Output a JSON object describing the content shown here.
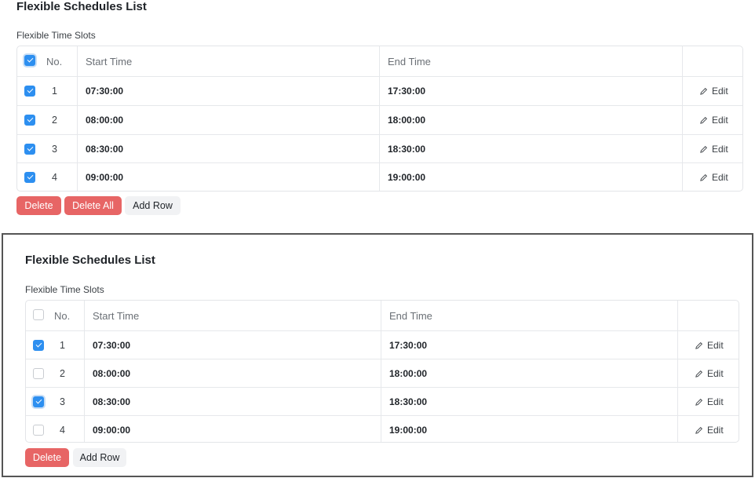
{
  "panels": [
    {
      "title": "Flexible Schedules List",
      "subtitle": "Flexible Time Slots",
      "header": {
        "no": "No.",
        "start": "Start Time",
        "end": "End Time",
        "select_all_checked": true
      },
      "rows": [
        {
          "no": "1",
          "start": "07:30:00",
          "end": "17:30:00",
          "checked": true,
          "edit": "Edit"
        },
        {
          "no": "2",
          "start": "08:00:00",
          "end": "18:00:00",
          "checked": true,
          "edit": "Edit"
        },
        {
          "no": "3",
          "start": "08:30:00",
          "end": "18:30:00",
          "checked": true,
          "edit": "Edit"
        },
        {
          "no": "4",
          "start": "09:00:00",
          "end": "19:00:00",
          "checked": true,
          "edit": "Edit"
        }
      ],
      "buttons": {
        "delete": "Delete",
        "delete_all": "Delete All",
        "add_row": "Add Row"
      }
    },
    {
      "title": "Flexible Schedules List",
      "subtitle": "Flexible Time Slots",
      "header": {
        "no": "No.",
        "start": "Start Time",
        "end": "End Time",
        "select_all_checked": false
      },
      "rows": [
        {
          "no": "1",
          "start": "07:30:00",
          "end": "17:30:00",
          "checked": true,
          "edit": "Edit"
        },
        {
          "no": "2",
          "start": "08:00:00",
          "end": "18:00:00",
          "checked": false,
          "edit": "Edit"
        },
        {
          "no": "3",
          "start": "08:30:00",
          "end": "18:30:00",
          "checked": true,
          "edit": "Edit"
        },
        {
          "no": "4",
          "start": "09:00:00",
          "end": "19:00:00",
          "checked": false,
          "edit": "Edit"
        }
      ],
      "buttons": {
        "delete": "Delete",
        "add_row": "Add Row"
      }
    }
  ],
  "colors": {
    "accent": "#2d8ff0",
    "danger": "#e76565",
    "neutral_button": "#f1f2f4",
    "border": "#e3e5e8"
  },
  "icons": {
    "edit": "pencil-icon",
    "checkbox": "checkbox"
  }
}
